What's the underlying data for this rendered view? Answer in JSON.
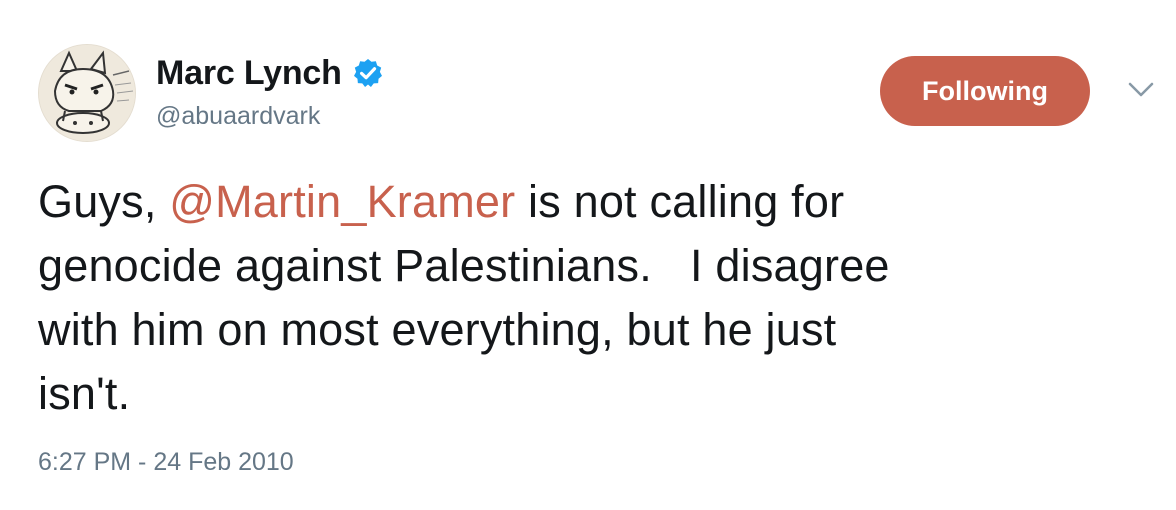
{
  "user": {
    "display_name": "Marc Lynch",
    "handle": "@abuaardvark",
    "verified_icon": "verified-badge-icon",
    "avatar_icon": "aardvark-cartoon-avatar"
  },
  "actions": {
    "follow_label": "Following",
    "menu_icon": "chevron-down-icon"
  },
  "tweet": {
    "text_before": "Guys, ",
    "mention": "@Martin_Kramer",
    "text_after": " is not calling for\ngenocide against Palestinians.   I disagree\nwith him on most everything, but he just\nisn't.",
    "timestamp": "6:27 PM - 24 Feb 2010"
  },
  "colors": {
    "accent": "#c8614d",
    "verified": "#1da1f2",
    "text": "#14171a",
    "secondary": "#657786"
  }
}
